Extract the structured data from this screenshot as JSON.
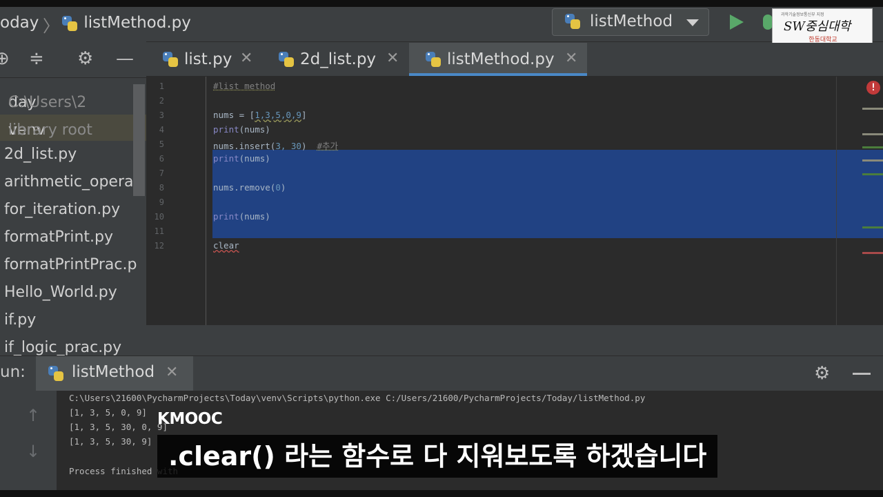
{
  "breadcrumb": {
    "project": "oday",
    "file": "listMethod.py"
  },
  "run_config": {
    "label": "listMethod"
  },
  "logo": {
    "tiny": "과학기술정보통신부 지정",
    "title": "SW중심대학",
    "university": "한동대학교"
  },
  "project_panel": {
    "root": {
      "name": "day",
      "path": "C:\\Users\\2"
    },
    "items": [
      {
        "label": "venv",
        "hint": "library root"
      },
      {
        "label": "2d_list.py"
      },
      {
        "label": "arithmetic_operat"
      },
      {
        "label": "for_iteration.py"
      },
      {
        "label": "formatPrint.py"
      },
      {
        "label": "formatPrintPrac.p"
      },
      {
        "label": "Hello_World.py"
      },
      {
        "label": "if.py"
      },
      {
        "label": "if_logic_prac.py"
      }
    ]
  },
  "tabs": [
    {
      "label": "list.py",
      "active": false
    },
    {
      "label": "2d_list.py",
      "active": false
    },
    {
      "label": "listMethod.py",
      "active": true
    }
  ],
  "editor": {
    "line_numbers": [
      "1",
      "2",
      "3",
      "4",
      "5",
      "6",
      "7",
      "8",
      "9",
      "10",
      "11",
      "12"
    ],
    "lines": {
      "l1": "#list method",
      "l3_a": "nums = [",
      "l3_b": "1,3,5,0,9",
      "l3_c": "]",
      "l4_fn": "print",
      "l4_arg": "(nums)",
      "l5_a": "nums.insert(",
      "l5_b": "3, 30",
      "l5_c": ")  ",
      "l5_cm": "#추가",
      "l6_fn": "print",
      "l6_arg": "(nums)",
      "l8_a": "nums.remove(",
      "l8_b": "0",
      "l8_c": ")",
      "l10_fn": "print",
      "l10_arg": "(nums)",
      "l12": "clear"
    }
  },
  "run_panel": {
    "label": "un:",
    "tab": "listMethod",
    "console": [
      "C:\\Users\\21600\\PycharmProjects\\Today\\venv\\Scripts\\python.exe C:/Users/21600/PycharmProjects/Today/listMethod.py",
      "[1, 3, 5, 0, 9]",
      "[1, 3, 5, 30, 0, 9]",
      "[1, 3, 5, 30, 9]",
      "",
      "Process finished with"
    ]
  },
  "overlay": {
    "watermark": "KMOOC",
    "subtitle": ".clear() 라는 함수로 다 지워보도록 하겠습니다"
  },
  "colors": {
    "selection": "#214283",
    "run_green": "#59a869",
    "error_red": "#c13a3a",
    "active_tab_underline": "#4a88c7"
  }
}
